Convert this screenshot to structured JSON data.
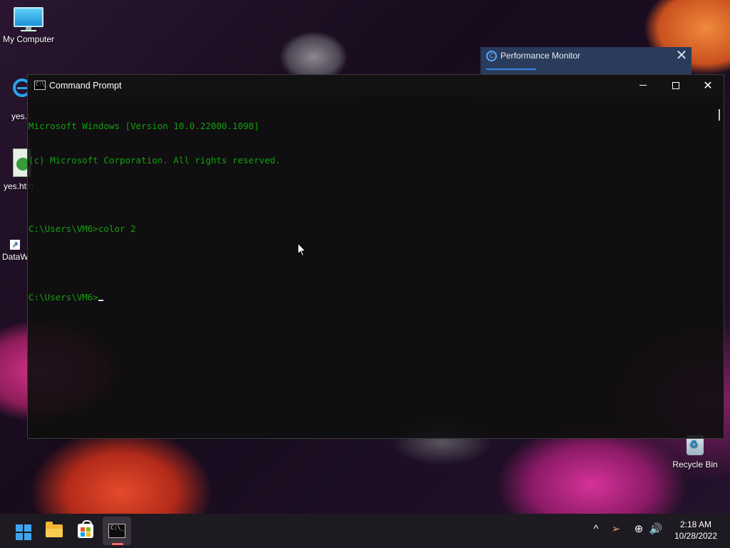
{
  "desktop": {
    "icons": [
      {
        "label": "My Computer"
      },
      {
        "label": "yes.l"
      },
      {
        "label": "yes.htm"
      },
      {
        "label": "DataW"
      },
      {
        "label": "Recycle Bin"
      }
    ]
  },
  "perf_monitor": {
    "title": "Performance Monitor",
    "close_glyph": "✕"
  },
  "cmd_window": {
    "title": "Command Prompt",
    "icon_text": "C:\\_",
    "close_glyph": "✕",
    "text_color": "#13a10e",
    "lines": [
      "Microsoft Windows [Version 10.0.22000.1098]",
      "(c) Microsoft Corporation. All rights reserved.",
      "",
      "C:\\Users\\VM6>color 2",
      "",
      "C:\\Users\\VM6>"
    ]
  },
  "taskbar": {
    "apps": [
      {
        "name": "start",
        "icon": "windows-logo-icon"
      },
      {
        "name": "file-explorer",
        "icon": "folder-icon"
      },
      {
        "name": "microsoft-store",
        "icon": "store-icon"
      },
      {
        "name": "command-prompt",
        "icon": "terminal-icon",
        "active": true
      }
    ],
    "tray": {
      "chevron": "^",
      "location": "➢",
      "network": "⊕",
      "volume": "🔊",
      "time": "2:18 AM",
      "date": "10/28/2022"
    }
  }
}
